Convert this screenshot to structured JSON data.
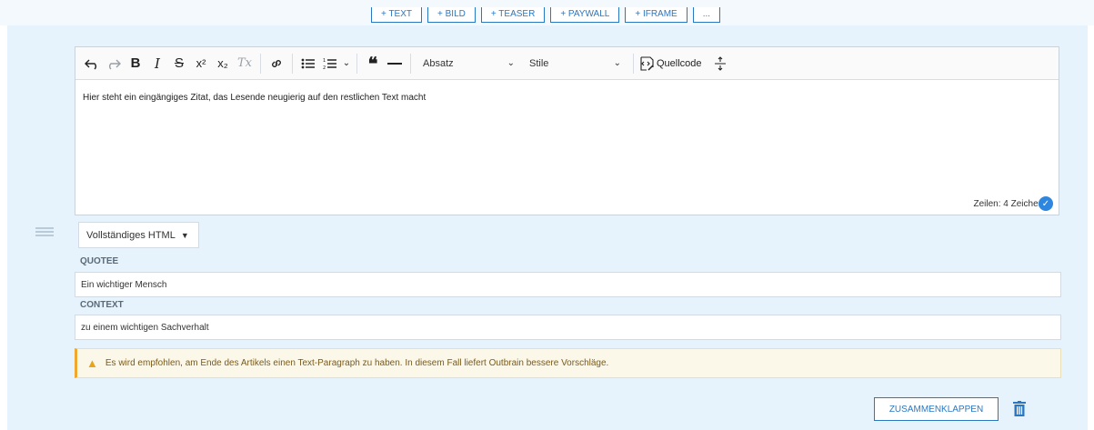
{
  "top_tools": [
    "+ TEXT",
    "+ BILD",
    "+ TEASER",
    "+ PAYWALL",
    "+ IFRAME",
    "..."
  ],
  "toolbar": {
    "undo_icon": "undo-icon",
    "redo_icon": "redo-icon",
    "bold": "B",
    "italic": "I",
    "strike": "S",
    "superscript": "x²",
    "subscript": "x₂",
    "remove_format": "Tx",
    "link_icon": "link-icon",
    "bullet_icon": "bullet-list-icon",
    "numbered_icon": "numbered-list-icon",
    "quote_icon": "blockquote-icon",
    "hr_icon": "horizontal-line-icon",
    "paragraph_format": "Absatz",
    "styles": "Stile",
    "source_label": "Quellcode",
    "source_icon": "source-code-icon",
    "expand_icon": "expand-icon"
  },
  "editor": {
    "content": "Hier steht ein eingängiges Zitat, das Lesende neugierig auf den restlichen Text macht",
    "status": "Zeilen: 4 Zeichen:"
  },
  "format_select": "Vollständiges HTML",
  "quotee": {
    "label": "QUOTEE",
    "value": "Ein wichtiger Mensch"
  },
  "context": {
    "label": "CONTEXT",
    "value": "zu einem wichtigen Sachverhalt"
  },
  "warning": "Es wird empfohlen, am Ende des Artikels einen Text-Paragraph zu haben. In diesem Fall liefert Outbrain bessere Vorschläge.",
  "collapse_button": "ZUSAMMENKLAPPEN",
  "colors": {
    "accent": "#2b78c2",
    "panel": "#e6f3fc",
    "warning_border": "#f0a72d"
  }
}
